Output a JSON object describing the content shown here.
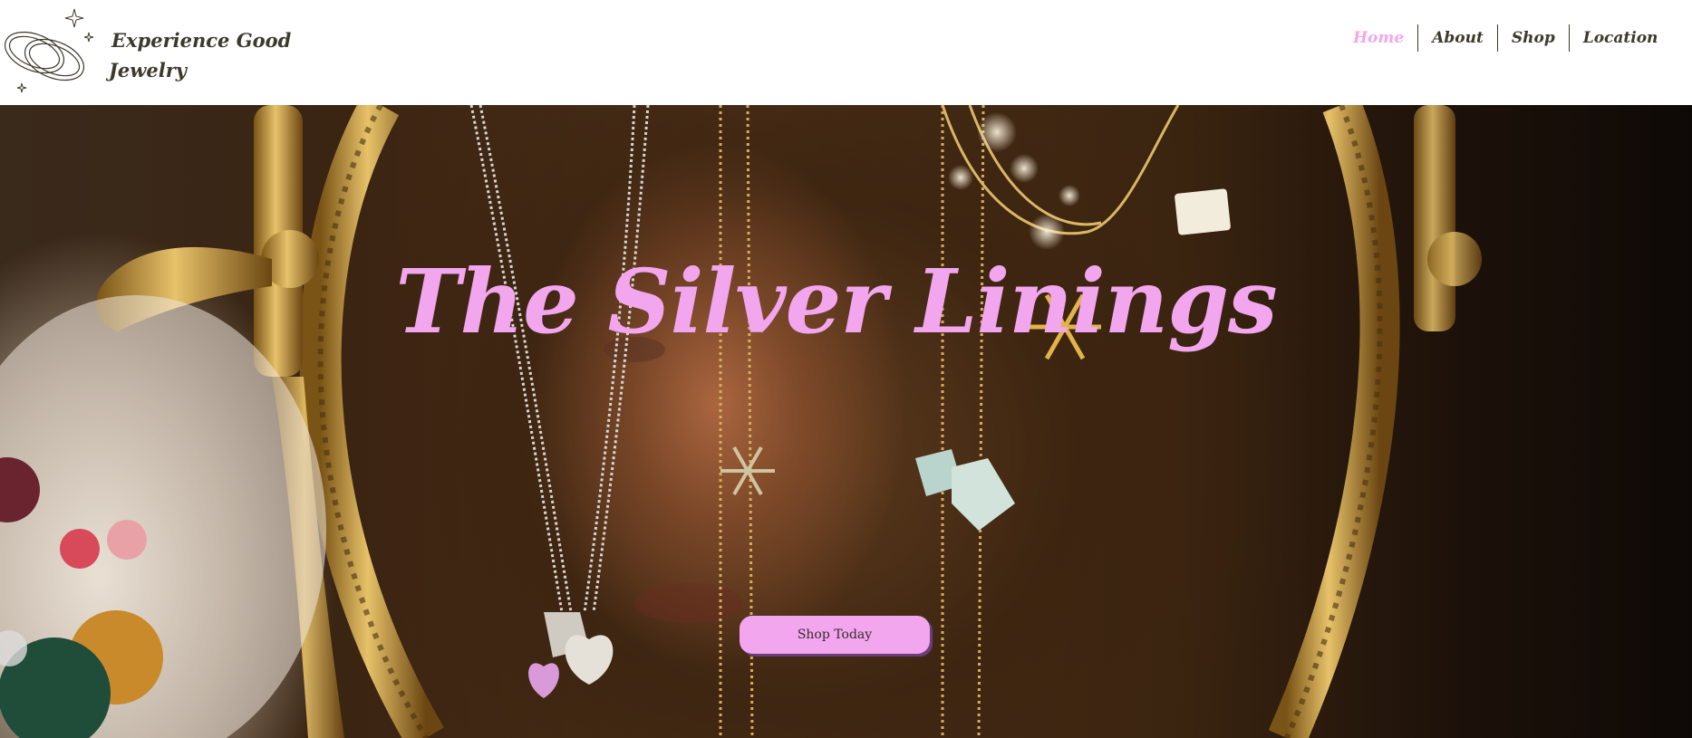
{
  "brand": {
    "line1": "Experience Good",
    "line2": "Jewelry",
    "logo_icon": "rings-icon"
  },
  "nav": {
    "items": [
      {
        "label": "Home",
        "active": true
      },
      {
        "label": "About",
        "active": false
      },
      {
        "label": "Shop",
        "active": false
      },
      {
        "label": "Location",
        "active": false
      }
    ]
  },
  "hero": {
    "title": "The Silver Linings",
    "cta_label": "Shop Today",
    "image_description_icon": "jewelry-display-photo"
  },
  "colors": {
    "accent": "#f2a6ee",
    "text": "#3c3a2c",
    "header_bg": "#ffffff"
  }
}
